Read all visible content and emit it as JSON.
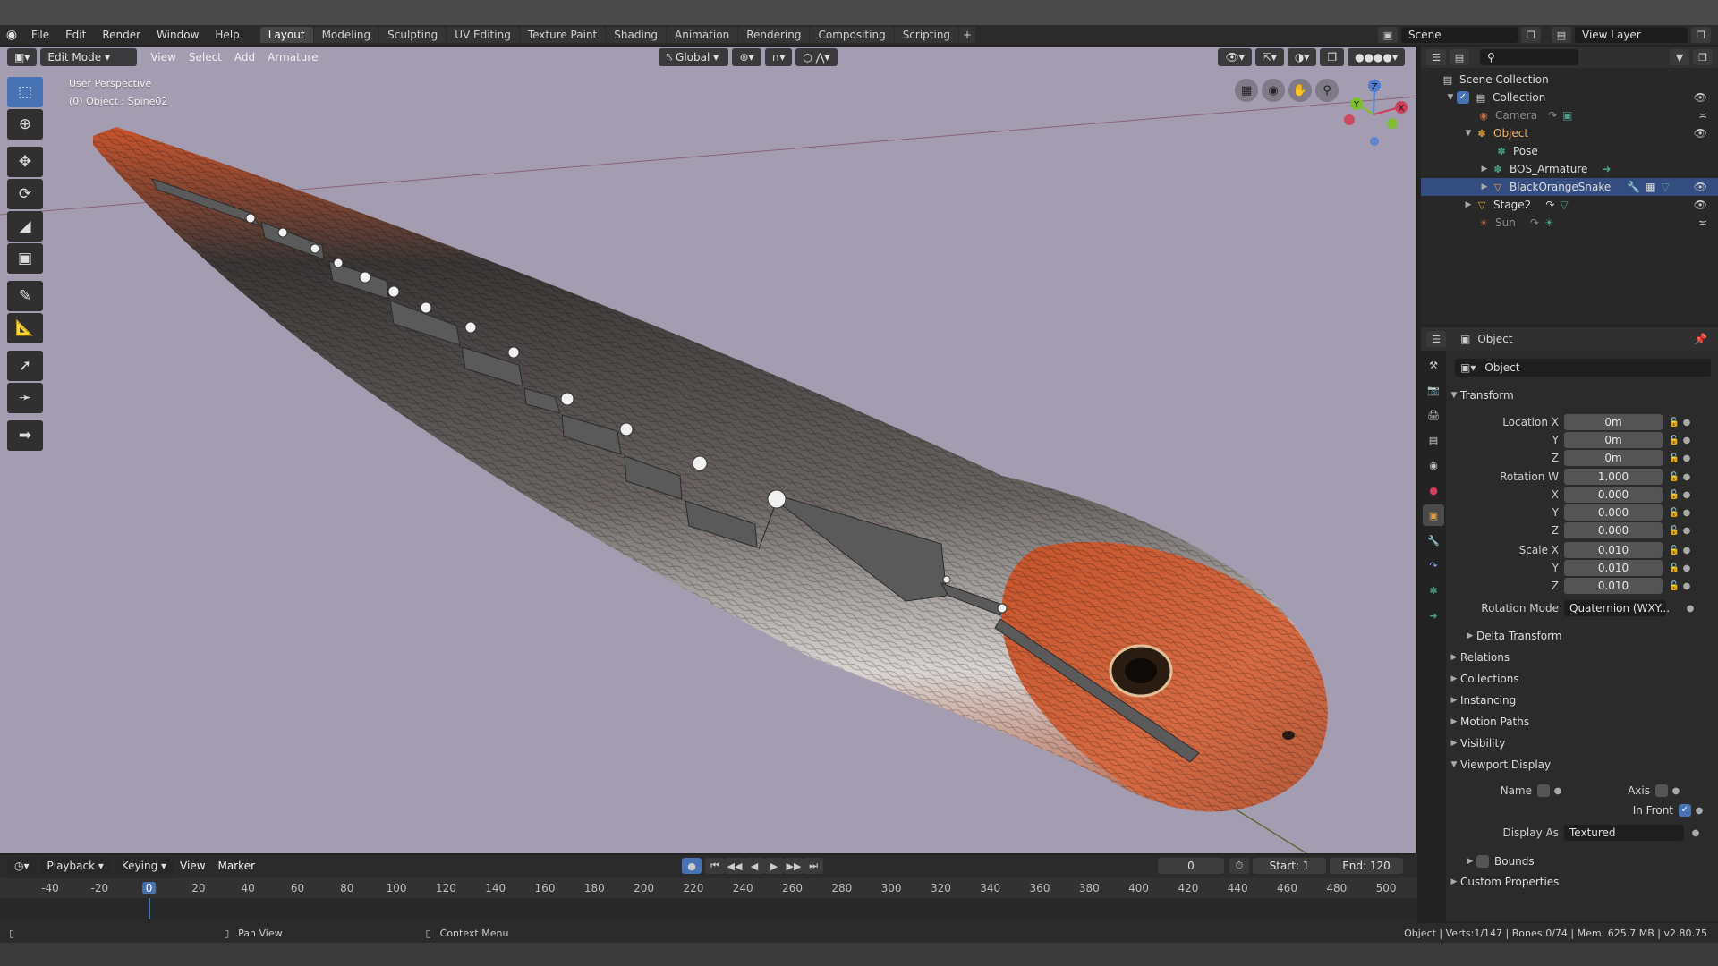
{
  "topbar": {
    "menus": [
      "File",
      "Edit",
      "Render",
      "Window",
      "Help"
    ],
    "workspaces": [
      "Layout",
      "Modeling",
      "Sculpting",
      "UV Editing",
      "Texture Paint",
      "Shading",
      "Animation",
      "Rendering",
      "Compositing",
      "Scripting"
    ],
    "active_workspace": "Layout",
    "add_tab": "+",
    "scene": "Scene",
    "view_layer": "View Layer"
  },
  "viewport": {
    "mode": "Edit Mode",
    "menus": [
      "View",
      "Select",
      "Add",
      "Armature"
    ],
    "orientation": "Global",
    "perspective_label": "User Perspective",
    "object_label": "(0) Object : Spine02",
    "gizmo": {
      "z": "Z",
      "y": "Y",
      "x": "X"
    },
    "colors": {
      "background": "#a49cb0",
      "accent": "#4772b3"
    }
  },
  "tools": [
    "select-box-icon",
    "cursor-icon",
    "move-icon",
    "rotate-icon",
    "scale-icon",
    "transform-icon",
    "annotate-icon",
    "measure-icon",
    "bone-roll-icon",
    "bone-size-icon",
    "extrude-icon"
  ],
  "timeline": {
    "menus": [
      "Playback",
      "Keying",
      "View",
      "Marker"
    ],
    "current_frame": "0",
    "start_label": "Start:",
    "start": "1",
    "end_label": "End:",
    "end": "120",
    "ticks": [
      "-40",
      "-20",
      "0",
      "20",
      "40",
      "60",
      "80",
      "100",
      "120",
      "140",
      "160",
      "180",
      "200",
      "220",
      "240",
      "260",
      "280",
      "300",
      "320",
      "340",
      "360",
      "380",
      "400",
      "420",
      "440",
      "460",
      "480",
      "500"
    ]
  },
  "status": {
    "pan_view": "Pan View",
    "context_menu": "Context Menu",
    "stats": "Object | Verts:1/147 | Bones:0/74 | Mem: 625.7 MB | v2.80.75"
  },
  "outliner": {
    "rows": [
      {
        "label": "Scene Collection"
      },
      {
        "label": "Collection"
      },
      {
        "label": "Camera"
      },
      {
        "label": "Object"
      },
      {
        "label": "Pose"
      },
      {
        "label": "BOS_Armature"
      },
      {
        "label": "BlackOrangeSnake"
      },
      {
        "label": "Stage2"
      },
      {
        "label": "Sun"
      }
    ]
  },
  "properties": {
    "header_title": "Object",
    "object_name": "Object",
    "transform_label": "Transform",
    "location": {
      "label_x": "Location X",
      "label_y": "Y",
      "label_z": "Z",
      "x": "0m",
      "y": "0m",
      "z": "0m"
    },
    "rotation": {
      "label_w": "Rotation W",
      "label_x": "X",
      "label_y": "Y",
      "label_z": "Z",
      "w": "1.000",
      "x": "0.000",
      "y": "0.000",
      "z": "0.000"
    },
    "scale": {
      "label_x": "Scale X",
      "label_y": "Y",
      "label_z": "Z",
      "x": "0.010",
      "y": "0.010",
      "z": "0.010"
    },
    "rotation_mode_label": "Rotation Mode",
    "rotation_mode": "Quaternion (WXY...",
    "delta_transform": "Delta Transform",
    "sections": [
      "Relations",
      "Collections",
      "Instancing",
      "Motion Paths",
      "Visibility"
    ],
    "viewport_display": "Viewport Display",
    "name_label": "Name",
    "axis_label": "Axis",
    "in_front_label": "In Front",
    "display_as_label": "Display As",
    "display_as": "Textured",
    "bounds_label": "Bounds",
    "custom_properties": "Custom Properties"
  }
}
